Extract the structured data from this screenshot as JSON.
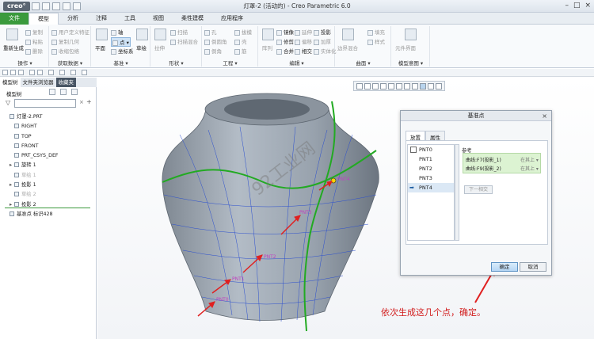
{
  "window": {
    "logo": "creo°",
    "title": "灯罩-2 (活动的) - Creo Parametric 6.0"
  },
  "ribbon_tabs": [
    "文件",
    "模型",
    "分析",
    "注释",
    "工具",
    "视图",
    "柔性建模",
    "应用程序"
  ],
  "ribbon": {
    "groups": [
      {
        "label": "操作 ▾",
        "items": [
          "重新生成",
          "复制",
          "粘贴",
          "删除"
        ]
      },
      {
        "label": "获取数据 ▾",
        "items": [
          "用户定义特征",
          "复制几何",
          "收缩包络"
        ]
      },
      {
        "label": "基准 ▾",
        "items": [
          "平面",
          "轴",
          "点 ▾",
          "坐标系",
          "草绘"
        ]
      },
      {
        "label": "形状 ▾",
        "items": [
          "拉伸",
          "扫描",
          "扫描混合"
        ]
      },
      {
        "label": "工程 ▾",
        "items": [
          "孔",
          "倒圆角",
          "倒角",
          "拔模",
          "壳",
          "筋"
        ]
      },
      {
        "label": "编辑 ▾",
        "items": [
          "阵列",
          "镜像",
          "修剪",
          "合并",
          "延伸",
          "偏移",
          "相交",
          "投影",
          "加厚",
          "实体化"
        ]
      },
      {
        "label": "曲面 ▾",
        "items": [
          "边界混合",
          "填充",
          "样式"
        ]
      },
      {
        "label": "模型意图 ▾",
        "items": [
          "元件界面"
        ]
      }
    ]
  },
  "left_panel": {
    "tabs": [
      "模型树",
      "文件夹浏览器",
      "收藏夹"
    ],
    "tree_header": "模型树",
    "tree": [
      {
        "label": "灯罩-2.PRT",
        "dim": false,
        "toggle": ""
      },
      {
        "label": "RIGHT",
        "dim": false,
        "toggle": ""
      },
      {
        "label": "TOP",
        "dim": false,
        "toggle": ""
      },
      {
        "label": "FRONT",
        "dim": false,
        "toggle": ""
      },
      {
        "label": "PRT_CSYS_DEF",
        "dim": false,
        "toggle": ""
      },
      {
        "label": "旋转 1",
        "dim": false,
        "toggle": "▸"
      },
      {
        "label": "草绘 1",
        "dim": true,
        "toggle": ""
      },
      {
        "label": "投影 1",
        "dim": false,
        "toggle": "▸"
      },
      {
        "label": "草绘 2",
        "dim": true,
        "toggle": ""
      },
      {
        "label": "投影 2",
        "dim": false,
        "toggle": "▸"
      },
      {
        "label": "基准点 标识428",
        "dim": false,
        "toggle": ""
      }
    ]
  },
  "dialog": {
    "title": "基准点",
    "tabs": [
      "放置",
      "属性"
    ],
    "points": [
      "PNT0",
      "PNT1",
      "PNT2",
      "PNT3",
      "PNT4"
    ],
    "selected_point": "PNT4",
    "reference_label": "参考",
    "references": [
      {
        "name": "曲线:F7(投影_1)",
        "constraint": "在其上 ▾"
      },
      {
        "name": "曲线:F9(投影_2)",
        "constraint": "在其上 ▾"
      }
    ],
    "next_button": "下一相交",
    "ok_button": "确定",
    "cancel_button": "取消"
  },
  "model_labels": [
    "PNT4",
    "PNT3",
    "PNT2",
    "PNT1",
    "PNT0"
  ],
  "watermark": "92工业网",
  "annotation": "依次生成这几个点，确定。",
  "colors": {
    "file_tab": "#3a9a3c",
    "curve": "#22aa22",
    "mesh": "#2b4fcf",
    "arrow": "#e02020",
    "annotation": "#d21e1e"
  }
}
